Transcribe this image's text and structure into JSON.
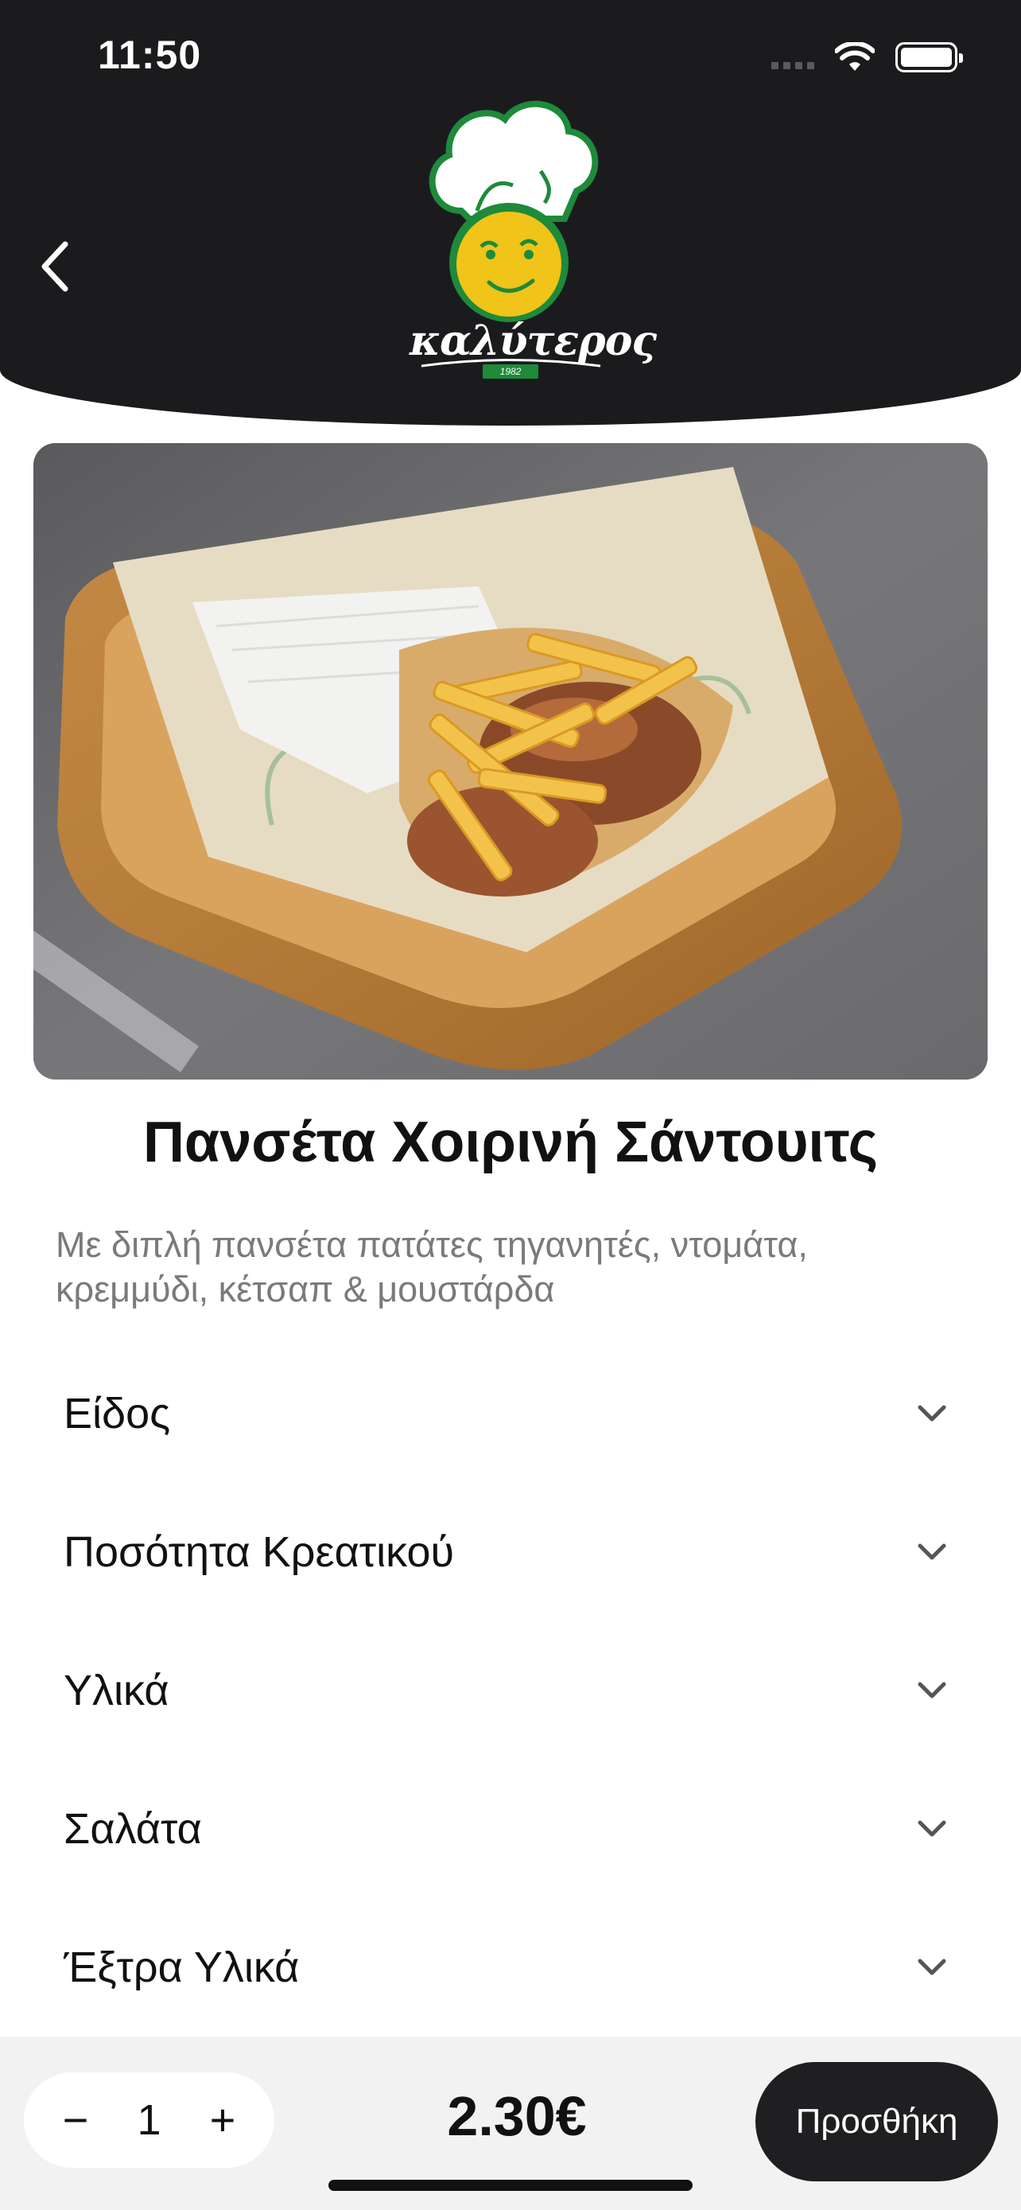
{
  "status_bar": {
    "time": "11:50"
  },
  "header": {
    "brand_name": "καλύτερος",
    "brand_year": "1982"
  },
  "product": {
    "title": "Πανσέτα Χοιρινή Σάντουιτς",
    "description": "Με διπλή πανσέτα πατάτες τηγανητές, ντομάτα, κρεμμύδι, κέτσαπ & μουστάρδα"
  },
  "options": [
    {
      "label": "Είδος"
    },
    {
      "label": "Ποσότητα Κρεατικού"
    },
    {
      "label": "Υλικά"
    },
    {
      "label": "Σαλάτα"
    },
    {
      "label": "Έξτρα Υλικά"
    }
  ],
  "bottom_bar": {
    "minus": "−",
    "quantity": "1",
    "plus": "+",
    "price": "2.30€",
    "add_label": "Προσθήκη"
  },
  "colors": {
    "header_bg": "#1b1b1e",
    "brand_green": "#1e8a3a",
    "brand_yellow": "#f0c419",
    "button_bg": "#1f1f21"
  }
}
